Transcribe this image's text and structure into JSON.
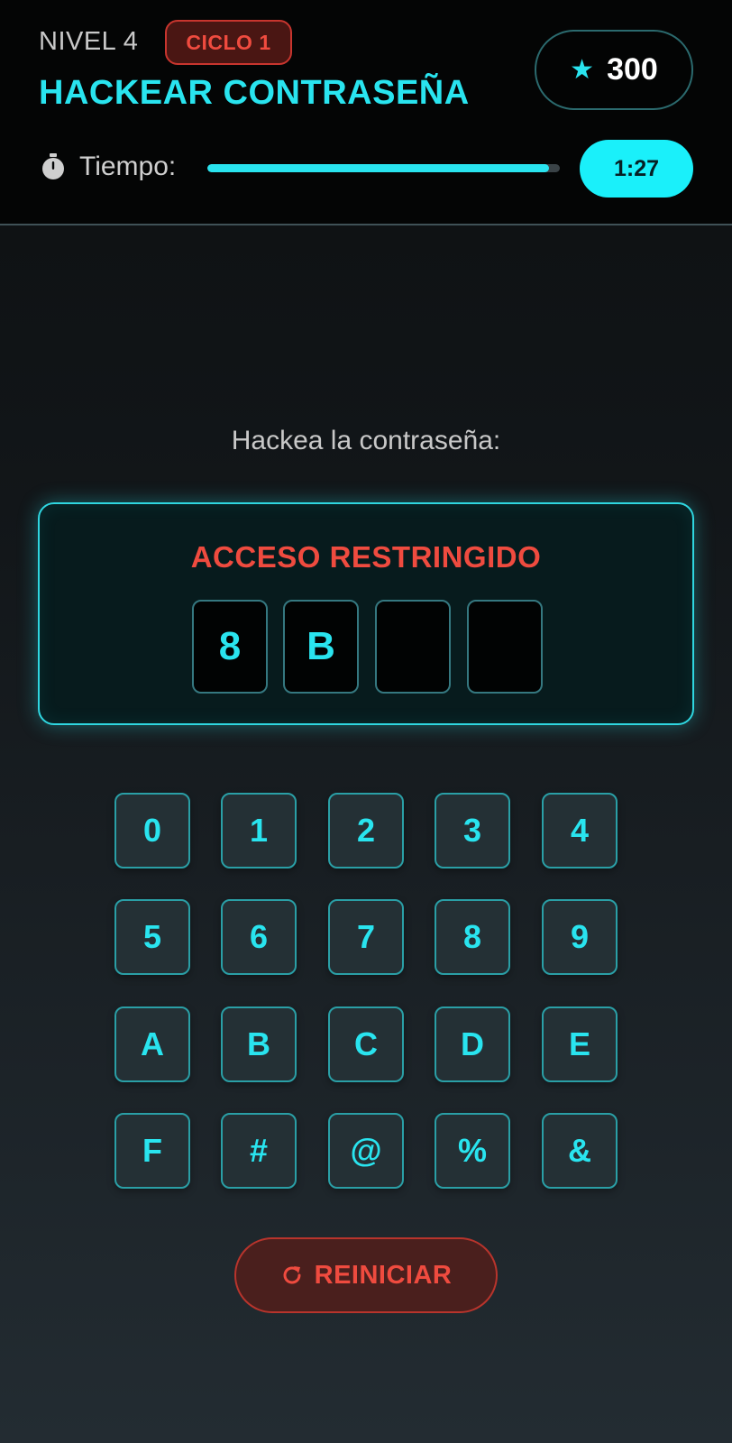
{
  "header": {
    "level_label": "NIVEL 4",
    "cycle_badge": "CICLO 1",
    "title": "HACKEAR CONTRASEÑA",
    "score": "300",
    "timer_label": "Tiempo:",
    "timer_value": "1:27",
    "timer_progress_fraction": 0.97
  },
  "instruction": "Hackea la contraseña:",
  "terminal": {
    "status": "ACCESO RESTRINGIDO",
    "slots": [
      "8",
      "B",
      "",
      ""
    ]
  },
  "keypad": {
    "keys": [
      "0",
      "1",
      "2",
      "3",
      "4",
      "5",
      "6",
      "7",
      "8",
      "9",
      "A",
      "B",
      "C",
      "D",
      "E",
      "F",
      "#",
      "@",
      "%",
      "&"
    ]
  },
  "reset_label": "REINICIAR",
  "icons": {
    "score": "star-icon",
    "timer": "stopwatch-icon",
    "reset": "refresh-icon"
  },
  "colors": {
    "accent": "#29e4ef",
    "danger": "#ef4b3f",
    "timer_pill": "#1af0fa"
  }
}
